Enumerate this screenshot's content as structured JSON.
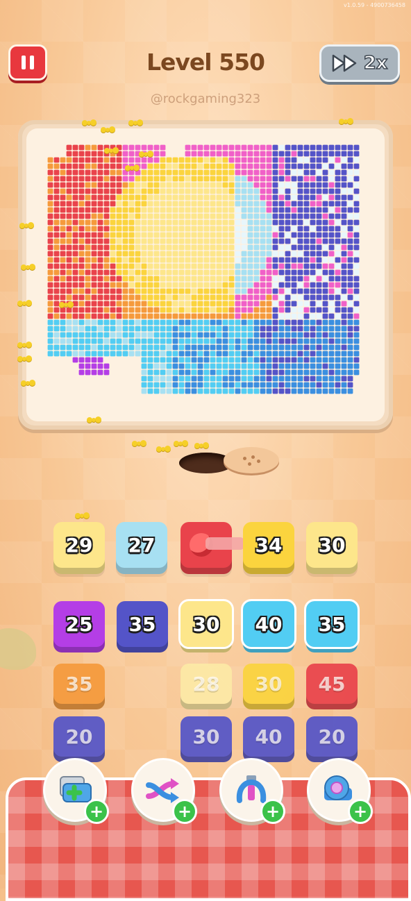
{
  "version": "v1.0.59 - 4900736458",
  "header": {
    "level_label": "Level 550",
    "watermark": "@rockgaming323",
    "speed_label": "2x"
  },
  "colors": {
    "yellow_light": "#fde68b",
    "blue_light": "#a7e0f2",
    "red": "#e9434b",
    "yellow": "#fbd43e",
    "purple": "#b43ee6",
    "indigo": "#5454c8",
    "orange": "#f59a3c",
    "sky": "#52cdf3",
    "pale_yellow": "#fdeaa6"
  },
  "queue": [
    {
      "value": "29",
      "color": "#fde68b"
    },
    {
      "value": "27",
      "color": "#a7e0f2"
    },
    {
      "value": "",
      "color": "#e9434b",
      "type": "cannon"
    },
    {
      "value": "34",
      "color": "#fbd43e"
    },
    {
      "value": "30",
      "color": "#fde68b"
    }
  ],
  "grid": [
    [
      {
        "value": "25",
        "color": "#b43ee6",
        "active": true
      },
      {
        "value": "35",
        "color": "#5454c8",
        "active": true
      },
      {
        "value": "30",
        "color": "#fde68b",
        "active": true,
        "selected": true
      },
      {
        "value": "40",
        "color": "#52cdf3",
        "active": true,
        "selected": true
      },
      {
        "value": "35",
        "color": "#52cdf3",
        "active": true,
        "selected": true
      }
    ],
    [
      {
        "value": "35",
        "color": "#f59a3c",
        "active": false
      },
      null,
      {
        "value": "28",
        "color": "#fdeaa6",
        "active": false
      },
      {
        "value": "30",
        "color": "#fbd43e",
        "active": false
      },
      {
        "value": "45",
        "color": "#e9434b",
        "active": false
      }
    ],
    [
      {
        "value": "20",
        "color": "#5454c8",
        "active": false
      },
      null,
      {
        "value": "30",
        "color": "#5454c8",
        "active": false
      },
      {
        "value": "40",
        "color": "#5454c8",
        "active": false
      },
      {
        "value": "20",
        "color": "#5454c8",
        "active": false
      }
    ]
  ],
  "boosters": [
    {
      "name": "add-slot-booster",
      "icon": "tray-plus-icon"
    },
    {
      "name": "shuffle-booster",
      "icon": "shuffle-arrows-icon"
    },
    {
      "name": "magnet-booster",
      "icon": "magnet-claw-icon"
    },
    {
      "name": "tape-booster",
      "icon": "tape-roll-icon"
    }
  ]
}
